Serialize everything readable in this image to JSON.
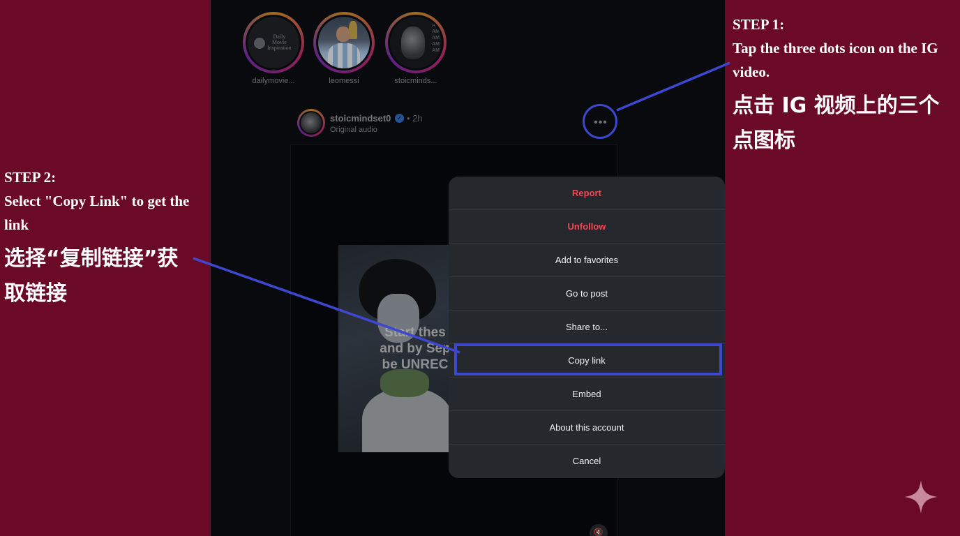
{
  "stories": [
    {
      "label": "dailymovie...",
      "logo_text": "Daily\nMovie\nInspiration"
    },
    {
      "label": "leomessi"
    },
    {
      "label": "stoicminds...",
      "logo_text": "AM\nAM\nAM\nAM\nAM"
    }
  ],
  "post": {
    "username": "stoicmindset0",
    "time": "• 2h",
    "audio": "Original audio",
    "more": "•••",
    "caption": "Start thes\nand by Sep\nbe UNREC"
  },
  "menu": [
    "Report",
    "Unfollow",
    "Add to favorites",
    "Go to post",
    "Share to...",
    "Copy link",
    "Embed",
    "About this account",
    "Cancel"
  ],
  "annotations": {
    "step1": {
      "title": "STEP 1:",
      "text": "Tap the three dots icon on the IG video.",
      "cn": "点击 IG 视频上的三个点图标"
    },
    "step2": {
      "title": "STEP 2:",
      "text": "Select \"Copy Link\" to get the link",
      "cn": "选择“复制链接”获取链接"
    }
  },
  "colors": {
    "background": "#6b0a27",
    "panel": "#0b0e12",
    "menu": "#25282d",
    "danger": "#ed4956",
    "highlight": "#3d47d0"
  }
}
